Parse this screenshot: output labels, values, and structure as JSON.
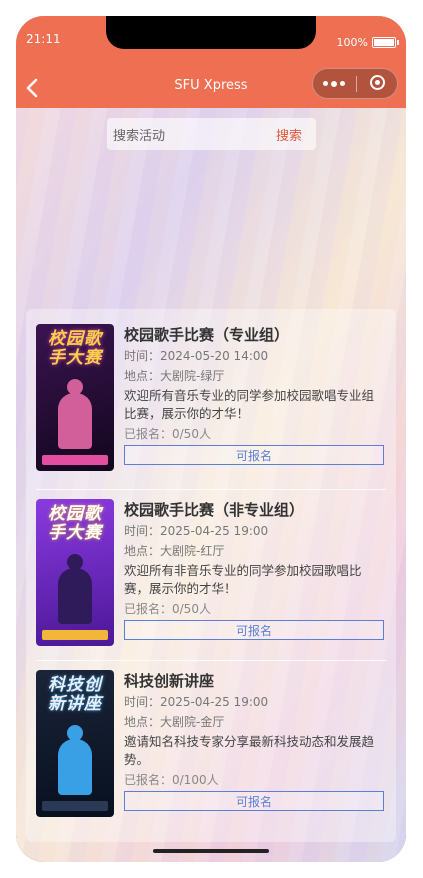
{
  "status_bar": {
    "time": "21:11",
    "battery": "100%"
  },
  "nav": {
    "title": "SFU Xpress"
  },
  "search": {
    "placeholder": "搜索活动",
    "button": "搜索"
  },
  "events": [
    {
      "title": "校园歌手比赛（专业组）",
      "time": "时间：2024-05-20 14:00",
      "location": "地点：大剧院-绿厅",
      "description": "欢迎所有音乐专业的同学参加校园歌唱专业组比赛，展示你的才华！",
      "registered": "已报名：0/50人",
      "button": "可报名",
      "poster_title": "校园歌手大赛",
      "poster_colors": {
        "bg": "#2a0f3c",
        "accent": "#e34fa0",
        "title": "#f6d24a"
      }
    },
    {
      "title": "校园歌手比赛（非专业组）",
      "time": "时间：2025-04-25 19:00",
      "location": "地点：大剧院-红厅",
      "description": "欢迎所有非音乐专业的同学参加校园歌唱比赛，展示你的才华！",
      "registered": "已报名：0/50人",
      "button": "可报名",
      "poster_title": "校园歌手大赛",
      "poster_colors": {
        "bg": "#6a2bc8",
        "accent": "#f2b63a",
        "title": "#ffffff"
      }
    },
    {
      "title": "科技创新讲座",
      "time": "时间：2025-04-25 19:00",
      "location": "地点：大剧院-金厅",
      "description": "邀请知名科技专家分享最新科技动态和发展趋势。",
      "registered": "已报名：0/100人",
      "button": "可报名",
      "poster_title": "科技创新讲座",
      "poster_colors": {
        "bg": "#0e1a2e",
        "accent": "#3aa0e6",
        "title": "#e9eef5"
      }
    }
  ]
}
